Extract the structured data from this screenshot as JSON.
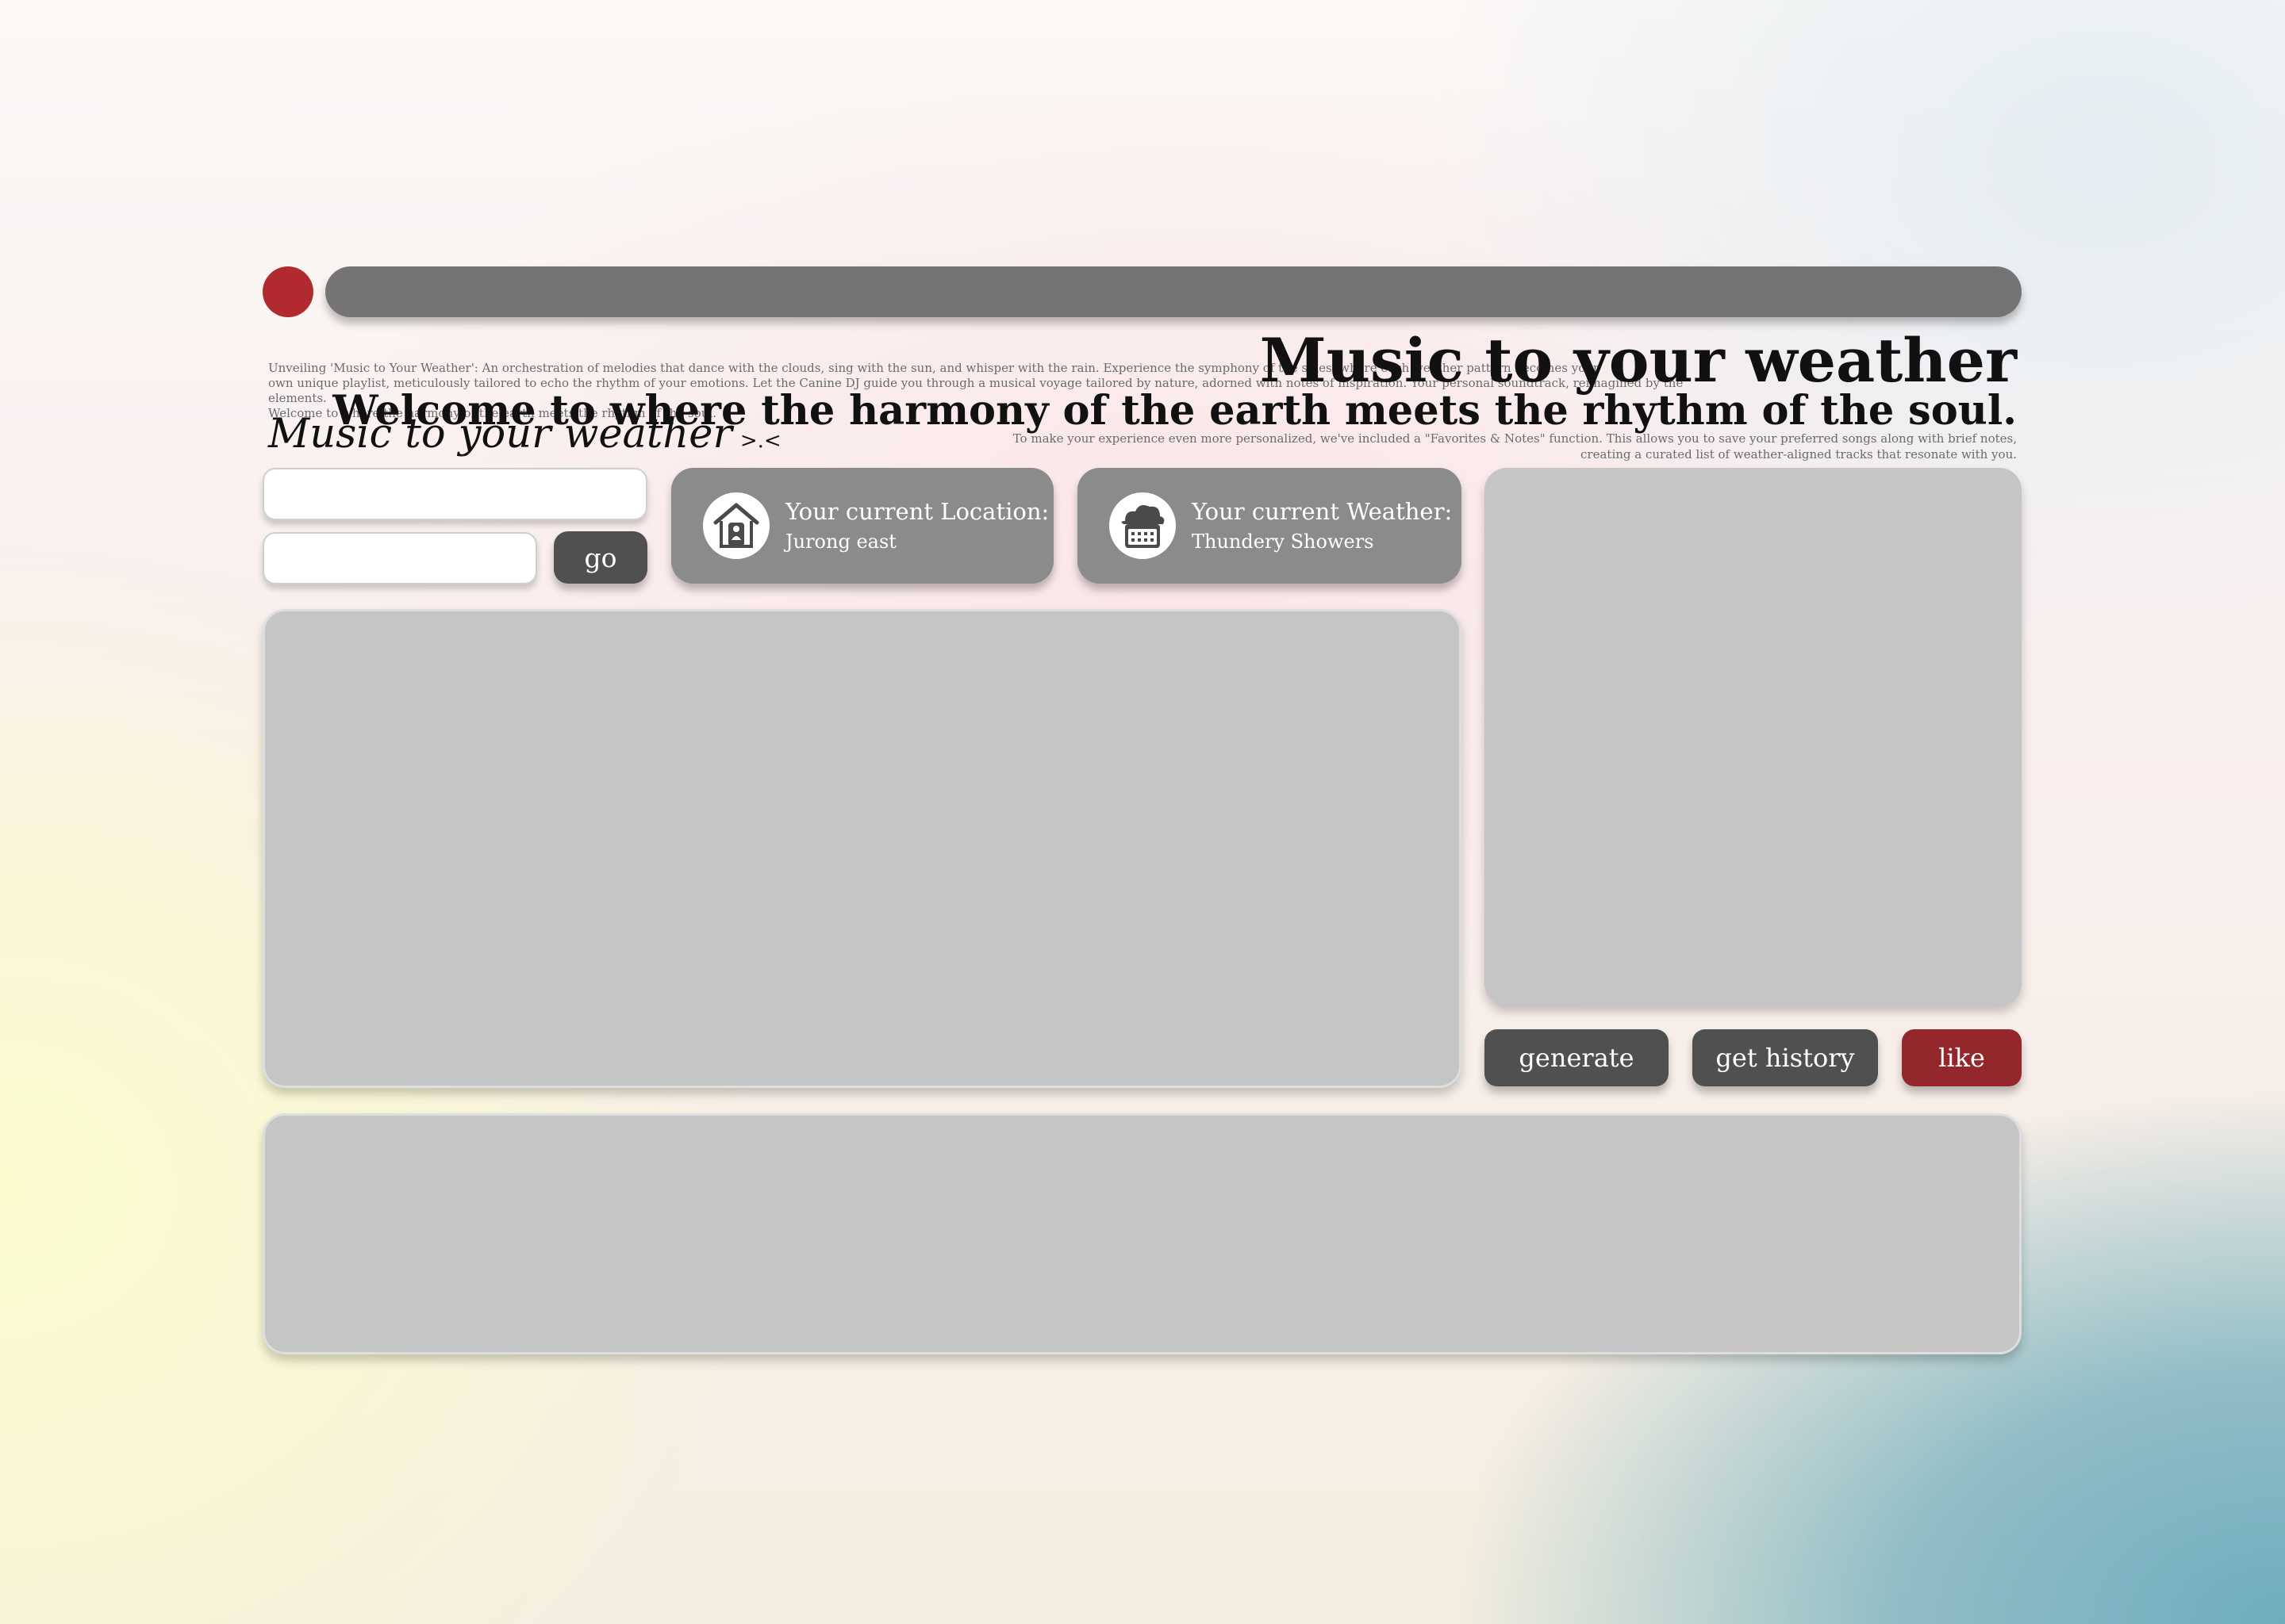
{
  "topbar": {
    "accent_color": "#b02a30",
    "bar_color": "#747474"
  },
  "intro": {
    "line1": "Unveiling 'Music to Your Weather': An orchestration of melodies that dance with the clouds, sing with the sun, and whisper with the rain. Experience the symphony of the skies, where each weather pattern becomes your",
    "line2": "own unique playlist, meticulously tailored to echo the rhythm of your emotions. Let the Canine DJ guide you through a musical voyage tailored by nature, adorned with notes of inspiration. Your personal soundtrack, reimagined by the elements.",
    "line3": "Welcome to where the harmony of the earth meets the rhythm of the soul."
  },
  "header": {
    "title": "Music to your weather",
    "subtitle": "Welcome to where the harmony of the earth meets the rhythm of the soul.",
    "note": "To make your experience even more personalized, we've included a \"Favorites & Notes\" function. This allows you to save your preferred songs along with brief notes, creating a curated list of weather-aligned tracks that resonate with you."
  },
  "brand": {
    "title": "Music to your weather",
    "suffix": ">.<"
  },
  "search": {
    "input1_value": "",
    "input2_value": "",
    "go_label": "go"
  },
  "location_card": {
    "icon": "house-icon",
    "label": "Your current Location:",
    "value": "Jurong east"
  },
  "weather_card": {
    "icon": "cloud-calendar-icon",
    "label": "Your current Weather:",
    "value": "Thundery Showers"
  },
  "actions": {
    "generate_label": "generate",
    "history_label": "get history",
    "like_label": "like",
    "like_color": "#93272c"
  }
}
